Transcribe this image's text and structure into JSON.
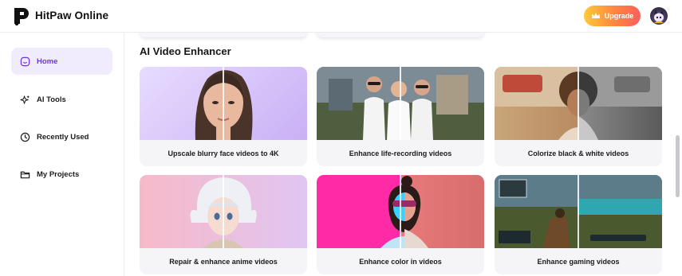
{
  "brand": {
    "name": "HitPaw Online"
  },
  "header": {
    "upgrade_label": "Upgrade",
    "upgrade_icon": "crown-icon"
  },
  "sidebar": {
    "items": [
      {
        "label": "Home",
        "icon": "home-smile-icon",
        "active": true
      },
      {
        "label": "AI Tools",
        "icon": "sparkle-icon",
        "active": false
      },
      {
        "label": "Recently Used",
        "icon": "clock-icon",
        "active": false
      },
      {
        "label": "My Projects",
        "icon": "folder-icon",
        "active": false
      }
    ]
  },
  "section": {
    "title": "AI Video Enhancer"
  },
  "cards": [
    {
      "label": "Upscale blurry face videos to 4K"
    },
    {
      "label": "Enhance life-recording videos"
    },
    {
      "label": "Colorize black & white videos"
    },
    {
      "label": "Repair & enhance anime videos"
    },
    {
      "label": "Enhance color in videos"
    },
    {
      "label": "Enhance gaming videos"
    }
  ],
  "colors": {
    "accent": "#6a35e8",
    "active_bg": "#f1ecfd",
    "upgrade_from": "#ffca3a",
    "upgrade_to": "#ff5d5d"
  }
}
